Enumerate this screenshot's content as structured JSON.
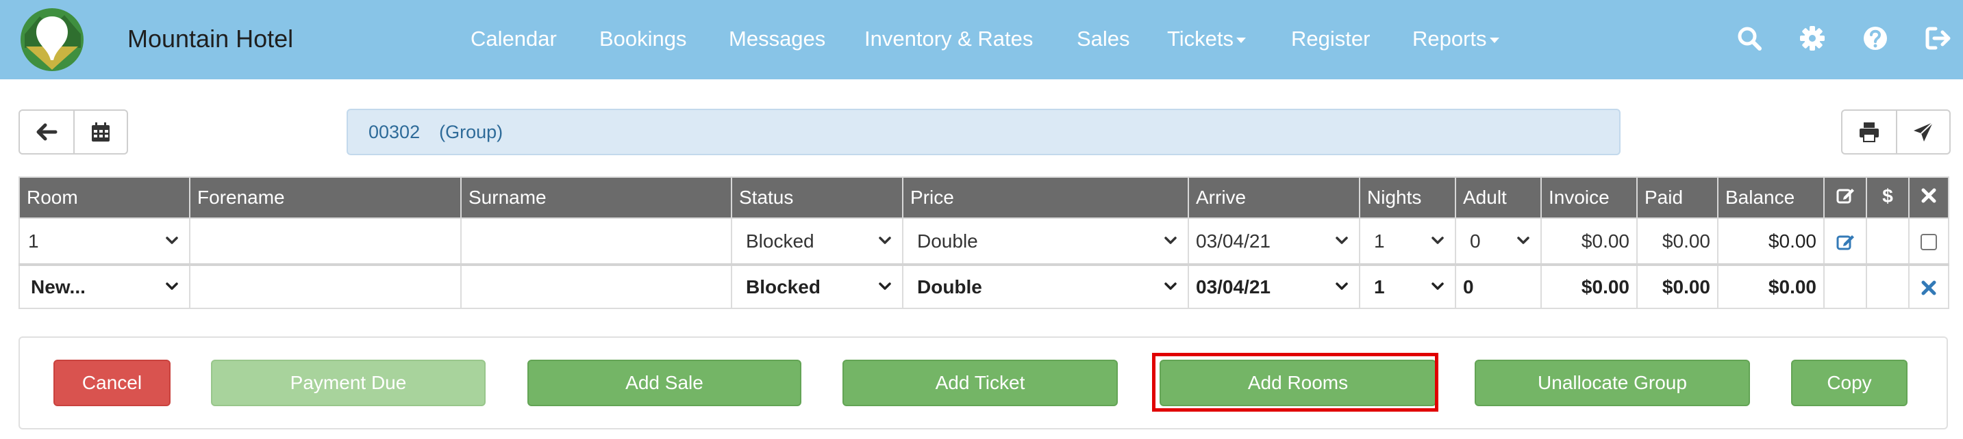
{
  "navbar": {
    "brand": "Mountain Hotel",
    "menu": [
      {
        "label": "Calendar",
        "dropdown": false
      },
      {
        "label": "Bookings",
        "dropdown": false
      },
      {
        "label": "Messages",
        "dropdown": false
      },
      {
        "label": "Inventory & Rates",
        "dropdown": false
      },
      {
        "label": "Sales",
        "dropdown": false
      },
      {
        "label": "Tickets",
        "dropdown": true
      },
      {
        "label": "Register",
        "dropdown": false
      },
      {
        "label": "Reports",
        "dropdown": true
      }
    ],
    "icons": [
      "search-icon",
      "gear-icon",
      "help-icon",
      "logout-icon"
    ],
    "colors": {
      "bar": "#88c4e7",
      "text": "#ffffff"
    }
  },
  "toolbar": {
    "left_icons": [
      "back-arrow-icon",
      "calendar-icon"
    ],
    "booking_number": "00302",
    "booking_type": "(Group)",
    "right_icons": [
      "print-icon",
      "send-icon"
    ]
  },
  "table": {
    "columns": [
      "Room",
      "Forename",
      "Surname",
      "Status",
      "Price",
      "Arrive",
      "Nights",
      "Adult",
      "Invoice",
      "Paid",
      "Balance"
    ],
    "icon_columns": [
      "edit-icon",
      "dollar-icon",
      "close-icon"
    ],
    "rows": [
      {
        "room": "1",
        "forename": "",
        "surname": "",
        "status": "Blocked",
        "price": "Double",
        "arrive": "03/04/21",
        "nights": "1",
        "adult": "0",
        "invoice": "$0.00",
        "paid": "$0.00",
        "balance": "$0.00"
      },
      {
        "room": "New...",
        "forename": "",
        "surname": "",
        "status": "Blocked",
        "price": "Double",
        "arrive": "03/04/21",
        "nights": "1",
        "adult": "0",
        "invoice": "$0.00",
        "paid": "$0.00",
        "balance": "$0.00"
      }
    ]
  },
  "actions": {
    "cancel": "Cancel",
    "payment_due": "Payment Due",
    "add_sale": "Add Sale",
    "add_ticket": "Add Ticket",
    "add_rooms": "Add Rooms",
    "unallocate_group": "Unallocate Group",
    "copy": "Copy"
  },
  "colors": {
    "header_bg": "#6b6b6b",
    "link": "#337ab7",
    "green": "#74b566",
    "red": "#d9534f",
    "highlight": "#e00000"
  }
}
